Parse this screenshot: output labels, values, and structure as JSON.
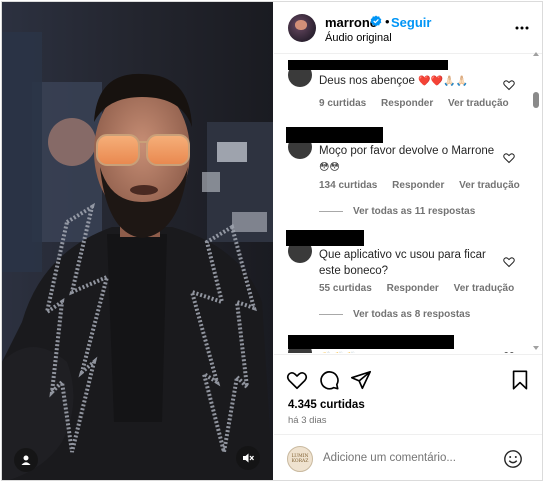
{
  "header": {
    "username": "marrone",
    "separator": "•",
    "follow_label": "Seguir",
    "audio_label": "Áudio original"
  },
  "comments": [
    {
      "text": "Deus nos abençoe",
      "emojis": "❤️❤️🙏🏻🙏🏻",
      "likes": "9 curtidas",
      "reply": "Responder",
      "translate": "Ver tradução"
    },
    {
      "text": "Moço por favor devolve o Marrone",
      "emojis": "😳😳",
      "likes": "134 curtidas",
      "reply": "Responder",
      "translate": "Ver tradução",
      "view_replies": "Ver todas as 11 respostas"
    },
    {
      "text": "Que aplicativo vc usou para ficar este boneco?",
      "likes": "55 curtidas",
      "reply": "Responder",
      "translate": "Ver tradução",
      "view_replies": "Ver todas as 8 respostas"
    },
    {
      "emojis": "👏👏👏"
    }
  ],
  "actions": {
    "likes_count": "4.345 curtidas",
    "time_ago": "há 3 dias"
  },
  "add_comment": {
    "placeholder": "Adicione um comentário...",
    "avatar_text": "LUMIN KORAZ"
  },
  "icons": {
    "verified": "verified-badge-icon",
    "more": "more-options-icon",
    "like": "heart-icon",
    "comment": "comment-icon",
    "share": "share-icon",
    "save": "bookmark-icon",
    "emoji": "emoji-icon",
    "mute": "muted-speaker-icon",
    "user": "user-tag-icon"
  },
  "colors": {
    "accent": "#0095f6",
    "secondary_text": "#737373",
    "divider": "#efefef"
  }
}
